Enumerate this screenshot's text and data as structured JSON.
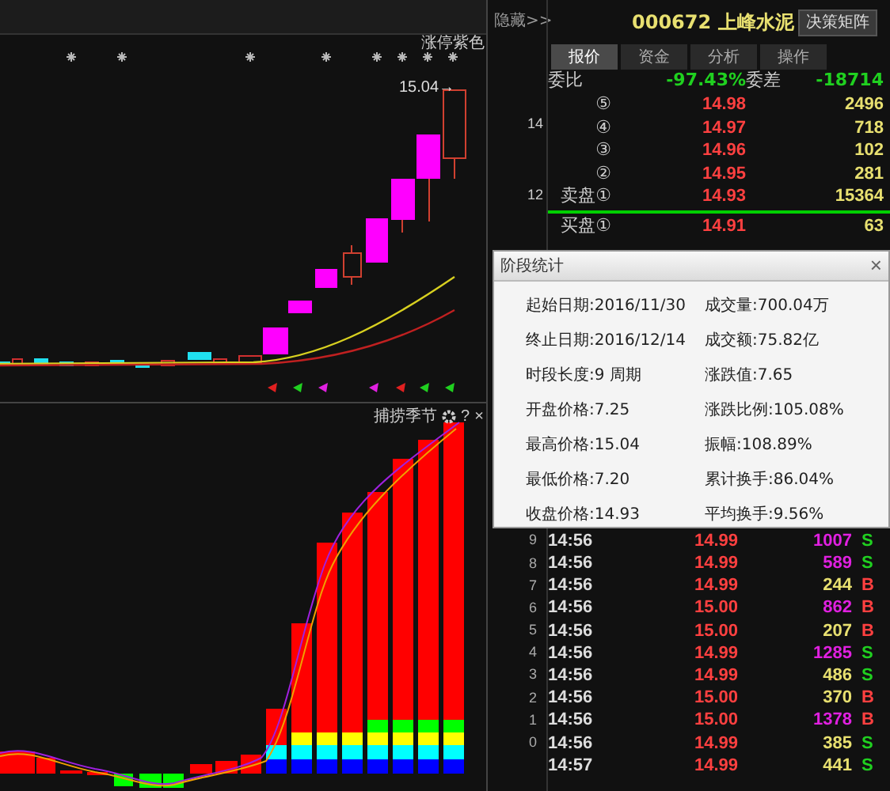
{
  "top_bar": {
    "hide_button": "隐藏>>"
  },
  "main_chart": {
    "legend": "涨停紫色",
    "high_label": "15.04→",
    "axis_labels": [
      "14",
      "12"
    ]
  },
  "indicator_panel": {
    "title": "捕捞季节",
    "help": "?",
    "close": "×"
  },
  "quote": {
    "code": "000672",
    "name": "上峰水泥",
    "button": "决策矩阵",
    "tabs": [
      {
        "label": "报价",
        "selected": true
      },
      {
        "label": "资金",
        "selected": false
      },
      {
        "label": "分析",
        "selected": false
      },
      {
        "label": "操作",
        "selected": false
      }
    ],
    "ratio_label": "委比",
    "ratio": "-97.43%",
    "diff_label": "委差",
    "diff": "-18714",
    "asks": [
      {
        "label": "⑤",
        "price": "14.98",
        "volume": "2496"
      },
      {
        "label": "④",
        "price": "14.97",
        "volume": "718"
      },
      {
        "label": "③",
        "price": "14.96",
        "volume": "102"
      },
      {
        "label": "②",
        "price": "14.95",
        "volume": "281"
      },
      {
        "label": "卖盘①",
        "price": "14.93",
        "volume": "15364"
      }
    ],
    "bids": [
      {
        "label": "买盘①",
        "price": "14.91",
        "volume": "63"
      }
    ]
  },
  "dialog": {
    "title": "阶段统计",
    "close": "×",
    "rows": [
      [
        "起始日期:2016/11/30",
        "成交量:700.04万"
      ],
      [
        "终止日期:2016/12/14",
        "成交额:75.82亿"
      ],
      [
        "时段长度:9 周期",
        "涨跌值:7.65"
      ],
      [
        "开盘价格:7.25",
        "涨跌比例:105.08%"
      ],
      [
        "最高价格:15.04",
        "振幅:108.89%"
      ],
      [
        "最低价格:7.20",
        "累计换手:86.04%"
      ],
      [
        "收盘价格:14.93",
        "平均换手:9.56%"
      ]
    ]
  },
  "ticks": [
    {
      "index": "9",
      "time": "14:56",
      "price": "14.99",
      "volume": "1007",
      "large": true,
      "side": "S"
    },
    {
      "index": "8",
      "time": "14:56",
      "price": "14.99",
      "volume": "589",
      "large": true,
      "side": "S"
    },
    {
      "index": "7",
      "time": "14:56",
      "price": "14.99",
      "volume": "244",
      "large": false,
      "side": "B"
    },
    {
      "index": "6",
      "time": "14:56",
      "price": "15.00",
      "volume": "862",
      "large": true,
      "side": "B"
    },
    {
      "index": "5",
      "time": "14:56",
      "price": "15.00",
      "volume": "207",
      "large": false,
      "side": "B"
    },
    {
      "index": "4",
      "time": "14:56",
      "price": "14.99",
      "volume": "1285",
      "large": true,
      "side": "S"
    },
    {
      "index": "3",
      "time": "14:56",
      "price": "14.99",
      "volume": "486",
      "large": false,
      "side": "S"
    },
    {
      "index": "2",
      "time": "14:56",
      "price": "15.00",
      "volume": "370",
      "large": false,
      "side": "B"
    },
    {
      "index": "1",
      "time": "14:56",
      "price": "15.00",
      "volume": "1378",
      "large": true,
      "side": "B"
    },
    {
      "index": "0",
      "time": "14:56",
      "price": "14.99",
      "volume": "385",
      "large": false,
      "side": "S"
    },
    {
      "time": "14:57",
      "price": "14.99",
      "volume": "441",
      "large": false,
      "side": "S"
    }
  ]
}
